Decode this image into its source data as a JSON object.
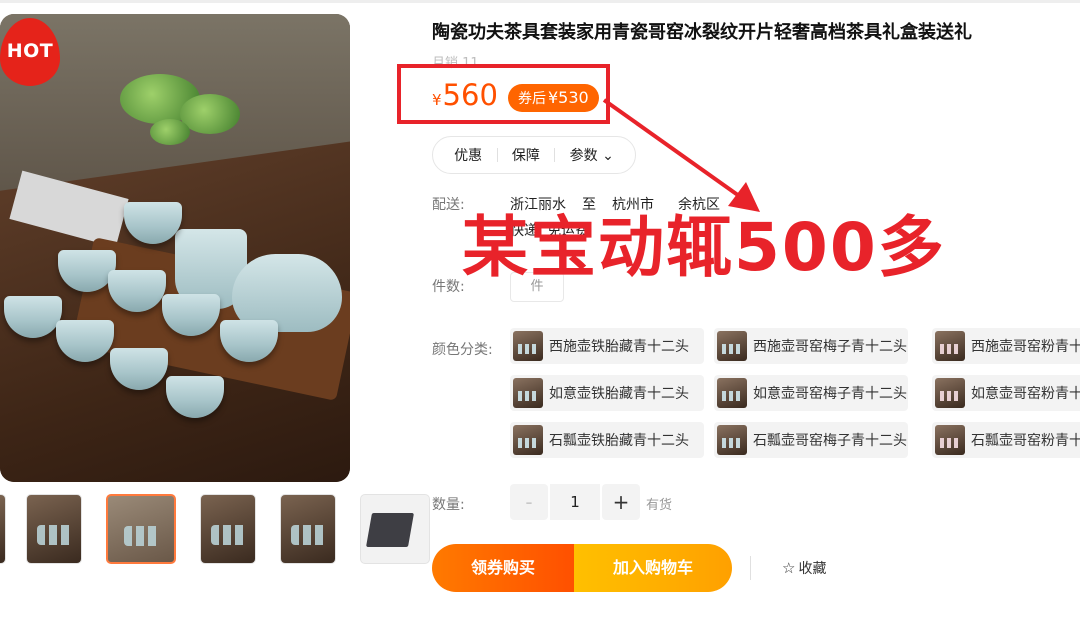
{
  "badge": {
    "label": "HOT"
  },
  "product": {
    "title": "陶瓷功夫茶具套装家用青瓷哥窑冰裂纹开片轻奢高档茶具礼盒装送礼",
    "sales": "月销 11",
    "price_currency": "¥",
    "price": "560",
    "coupon_prefix": "券后",
    "coupon_price": "¥530"
  },
  "info_tabs": [
    "优惠",
    "保障",
    "参数"
  ],
  "shipping": {
    "label": "配送:",
    "from": "浙江丽水",
    "to_word": "至",
    "city": "杭州市",
    "district": "余杭区",
    "fee": "快递: 免运费"
  },
  "pieces": {
    "label": "件数:",
    "value": "件"
  },
  "overlay_text": "某宝动辄500多",
  "color": {
    "label": "颜色分类:",
    "options": [
      [
        "西施壶铁胎藏青十二头",
        "西施壶哥窑梅子青十二头",
        "西施壶哥窑粉青十"
      ],
      [
        "如意壶铁胎藏青十二头",
        "如意壶哥窑梅子青十二头",
        "如意壶哥窑粉青十"
      ],
      [
        "石瓢壶铁胎藏青十二头",
        "石瓢壶哥窑梅子青十二头",
        "石瓢壶哥窑粉青十"
      ]
    ]
  },
  "quantity": {
    "label": "数量:",
    "minus": "-",
    "value": "1",
    "plus": "+",
    "stock": "有货"
  },
  "actions": {
    "buy": "领券购买",
    "cart": "加入购物车",
    "favorite": "收藏"
  },
  "colors": {
    "accent": "#ff5000",
    "highlight_red": "#e8232a",
    "cart": "#ffa000"
  }
}
